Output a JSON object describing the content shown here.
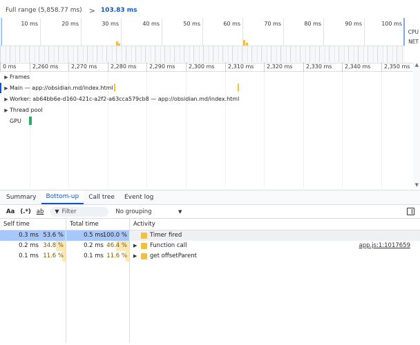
{
  "breadcrumb": {
    "full_range": "Full range (5,858.77 ms)",
    "separator": ">",
    "current": "103.83 ms"
  },
  "overview": {
    "ticks": [
      "10 ms",
      "20 ms",
      "30 ms",
      "40 ms",
      "50 ms",
      "60 ms",
      "70 ms",
      "80 ms",
      "90 ms",
      "100 ms"
    ],
    "side_labels": [
      "CPU",
      "NET"
    ]
  },
  "ruler": {
    "ticks": [
      "0 ms",
      "2,260 ms",
      "2,270 ms",
      "2,280 ms",
      "2,290 ms",
      "2,300 ms",
      "2,310 ms",
      "2,320 ms",
      "2,330 ms",
      "2,340 ms",
      "2,350 ms"
    ]
  },
  "tracks": {
    "frames": "Frames",
    "main": "Main — app://obsidian.md/index.html",
    "worker": "Worker: ab64bb6e-d160-421c-a2f2-a63cca579cb8 — app://obsidian.md/index.html",
    "thread_pool": "Thread pool",
    "gpu": "GPU"
  },
  "tabs": [
    "Summary",
    "Bottom-up",
    "Call tree",
    "Event log"
  ],
  "active_tab": "Bottom-up",
  "toolbar": {
    "match_case": "Aa",
    "regex": "(.*)",
    "whole_word": "ab",
    "filter_placeholder": "Filter",
    "grouping": "No grouping"
  },
  "table": {
    "headers": {
      "self": "Self time",
      "total": "Total time",
      "activity": "Activity"
    },
    "rows": [
      {
        "self_time": "0.3 ms",
        "self_pct": "53.6 %",
        "self_frac": 0.536,
        "total_time": "0.5 ms",
        "total_pct": "100.0 %",
        "total_frac": 1.0,
        "activity": "Timer fired",
        "expandable": false,
        "source": ""
      },
      {
        "self_time": "0.2 ms",
        "self_pct": "34.8 %",
        "self_frac": 0.348,
        "total_time": "0.2 ms",
        "total_pct": "46.4 %",
        "total_frac": 0.464,
        "activity": "Function call",
        "expandable": true,
        "source": "app.js:1:1017659"
      },
      {
        "self_time": "0.1 ms",
        "self_pct": "11.6 %",
        "self_frac": 0.116,
        "total_time": "0.1 ms",
        "total_pct": "11.6 %",
        "total_frac": 0.116,
        "activity": "get offsetParent",
        "expandable": true,
        "source": ""
      }
    ]
  },
  "colors": {
    "accent": "#0b57d0",
    "scripting": "#f1bf42",
    "gpu": "#27ae60",
    "selection": "#a8c7fa"
  }
}
